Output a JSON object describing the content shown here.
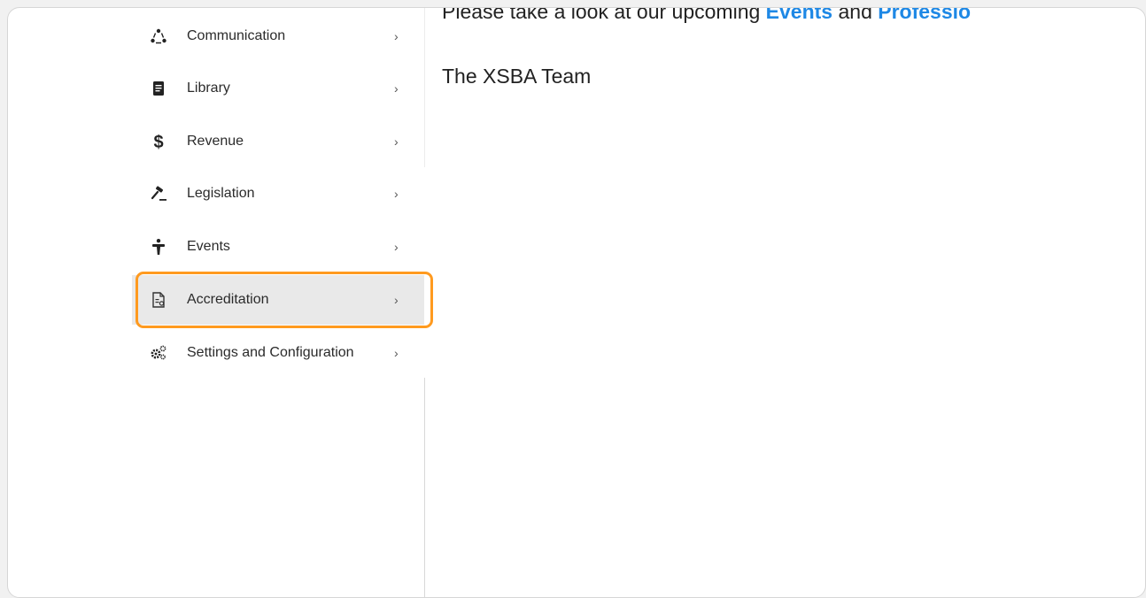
{
  "sidebar": {
    "items": [
      {
        "label": "Communication",
        "icon": "people-network-icon",
        "chevron": "›"
      },
      {
        "label": "Library",
        "icon": "book-icon",
        "chevron": "›"
      },
      {
        "label": "Revenue",
        "icon": "dollar-icon",
        "chevron": "›"
      },
      {
        "label": "Legislation",
        "icon": "gavel-icon",
        "chevron": "›"
      },
      {
        "label": "Events",
        "icon": "speaker-podium-icon",
        "chevron": "›"
      },
      {
        "label": "Accreditation",
        "icon": "certificate-document-icon",
        "chevron": "›",
        "selected": true
      },
      {
        "label": "Settings and Configuration",
        "icon": "gears-icon",
        "chevron": "›"
      }
    ]
  },
  "content": {
    "intro_prefix": "Please take a look at our upcoming ",
    "events_link": "Events",
    "intro_middle": " and ",
    "professional_link": "Professio",
    "signature": "The XSBA Team"
  },
  "colors": {
    "accent_link": "#1e88e5",
    "highlight": "#ff9a1f",
    "selected_bg": "#e9e9e9"
  }
}
